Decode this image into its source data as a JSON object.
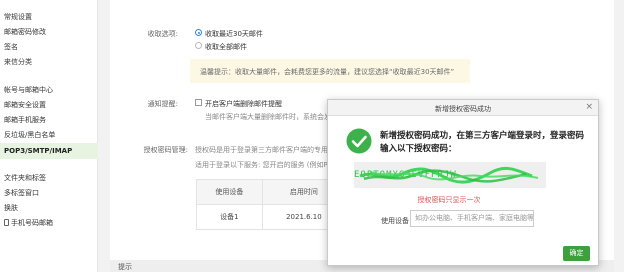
{
  "sidebar": {
    "items": [
      {
        "label": "常规设置",
        "active": false
      },
      {
        "label": "邮箱密码修改",
        "active": false
      },
      {
        "label": "签名",
        "active": false
      },
      {
        "label": "来信分类",
        "active": false
      },
      {
        "label": "帐号与邮箱中心",
        "active": false
      },
      {
        "label": "邮箱安全设置",
        "active": false
      },
      {
        "label": "邮箱手机服务",
        "active": false
      },
      {
        "label": "反垃圾/黑白名单",
        "active": false
      },
      {
        "label": "POP3/SMTP/IMAP",
        "active": true
      },
      {
        "label": "文件夹和标签",
        "active": false
      },
      {
        "label": "多标签窗口",
        "active": false
      },
      {
        "label": "换肤",
        "active": false
      },
      {
        "label": "手机号码邮箱",
        "active": false
      }
    ]
  },
  "settings": {
    "receive_label": "收取选项:",
    "receive_options": [
      "收取最近30天邮件",
      "收取全部邮件"
    ],
    "tip_text": "温馨提示：收取大量邮件，会耗费您更多的流量，建议您选择“收取最近30天邮件”",
    "notify_label": "通知提醒:",
    "notify_option": "开启客户端删除邮件提醒",
    "notify_desc": "当邮件客户端大量删除邮件时，系统会发送",
    "auth_label": "授权密码管理:",
    "auth_desc1": "授权码是用于登录第三方邮件客户端的专用密",
    "auth_desc2": "适用于登录以下服务: 您开启的服务 (例如POP",
    "table": {
      "headers": [
        "使用设备",
        "启用时间"
      ],
      "rows": [
        [
          "设备1",
          "2021.6.10"
        ]
      ]
    },
    "bottom_section": "提示"
  },
  "modal": {
    "title": "新增授权密码成功",
    "close": "×",
    "message": "新增授权密码成功，在第三方客户端登录时，登录密码输入以下授权密码：",
    "code": "EQPTOMXGJSVFPRJW",
    "once_note": "授权密码只显示一次",
    "device_label": "使用设备",
    "device_placeholder": "如办公电脑、手机客户端、家庭电脑等",
    "ok_label": "确定",
    "colors": {
      "success": "#3db14a",
      "primary_button": "#3d9f3d",
      "note": "#d9534f"
    }
  }
}
